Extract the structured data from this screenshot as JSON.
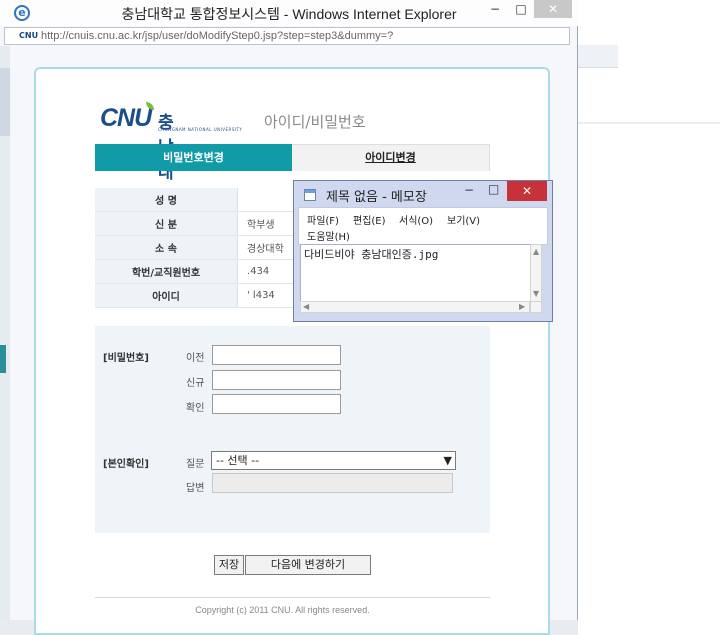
{
  "browser": {
    "title": "충남대학교 통합정보시스템 - Windows Internet Explorer",
    "url": "http://cnuis.cnu.ac.kr/jsp/user/doModifyStep0.jsp?step=step3&dummy=?",
    "addr_icon": "CNU",
    "min_glyph": "−",
    "max_glyph": "□",
    "close_glyph": "✕"
  },
  "logo": {
    "brand": "CNU",
    "korean": "충남대학교",
    "english": "CHUNGNAM NATIONAL UNIVERSITY"
  },
  "page_title": "아이디/비밀번호",
  "tabs": {
    "password": "비밀번호변경",
    "id": "아이디변경"
  },
  "info": [
    {
      "label": "성 명",
      "value": ""
    },
    {
      "label": "신 분",
      "value": "학부생"
    },
    {
      "label": "소 속",
      "value": "경상대학"
    },
    {
      "label": "학번/교직원번호",
      "value": ".434"
    },
    {
      "label": "아이디",
      "value": "'      l434"
    }
  ],
  "password_section": {
    "title": "[비밀번호]",
    "prev_label": "이전",
    "new_label": "신규",
    "confirm_label": "확인"
  },
  "identity_section": {
    "title": "[본인확인]",
    "question_label": "질문",
    "question_selected": "-- 선택 --",
    "answer_label": "답변"
  },
  "buttons": {
    "save": "저장",
    "later": "다음에 변경하기"
  },
  "copyright": "Copyright (c) 2011 CNU. All rights reserved.",
  "notepad": {
    "title": "제목 없음 - 메모장",
    "menu": [
      "파일(F)",
      "편집(E)",
      "서식(O)",
      "보기(V)",
      "도움말(H)"
    ],
    "content": "다비드비야 충남대인증.jpg"
  },
  "colors": {
    "teal_tab": "#109ba6",
    "logo_blue": "#1c4e8c",
    "notepad_close": "#c7313a"
  }
}
